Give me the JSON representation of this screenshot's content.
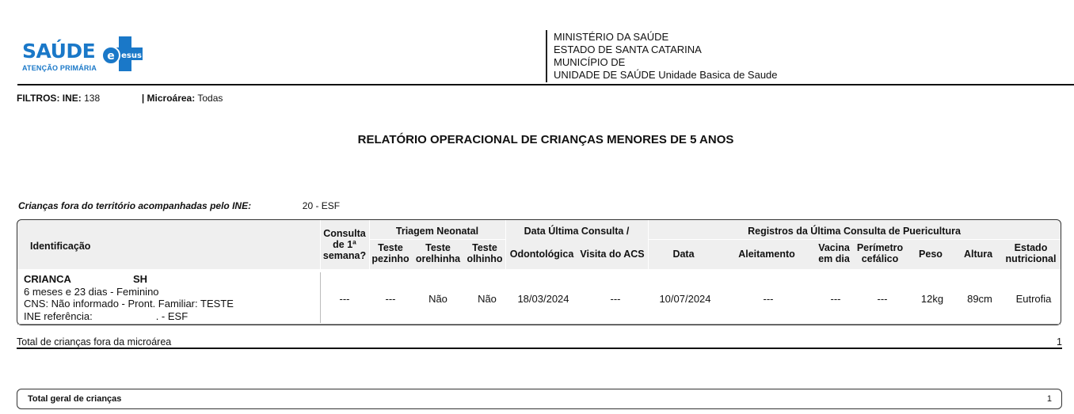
{
  "logo": {
    "word": "SAÚDE",
    "sub": "ATENÇÃO PRIMÁRIA",
    "badge": "esus"
  },
  "header": {
    "line1": "MINISTÉRIO DA SAÚDE",
    "line2": "ESTADO DE SANTA CATARINA",
    "line3": "MUNICÍPIO DE",
    "line4": "UNIDADE DE SAÚDE Unidade Basica de Saude"
  },
  "filters": {
    "ine_label": "FILTROS: INE:",
    "ine_value": "138",
    "microarea_label": "| Microárea:",
    "microarea_value": "Todas"
  },
  "title": "RELATÓRIO OPERACIONAL DE CRIANÇAS MENORES DE 5 ANOS",
  "section": {
    "label": "Crianças fora do território acompanhadas pelo INE:",
    "value": "20 - ESF"
  },
  "table": {
    "headers": {
      "identificacao": "Identificação",
      "consulta": [
        "Consulta",
        "de 1ª",
        "semana?"
      ],
      "triagem": "Triagem Neonatal",
      "teste_pezinho": [
        "Teste",
        "pezinho"
      ],
      "teste_orelhinha": [
        "Teste",
        "orelhinha"
      ],
      "teste_olhinho": [
        "Teste",
        "olhinho"
      ],
      "data_ultima": "Data Última Consulta /",
      "odontologica": "Odontológica",
      "visita_acs": "Visita do ACS",
      "registros": "Registros da Última Consulta de Puericultura",
      "data": "Data",
      "aleitamento": "Aleitamento",
      "vacina": [
        "Vacina",
        "em dia"
      ],
      "perimetro": [
        "Perímetro",
        "cefálico"
      ],
      "peso": "Peso",
      "altura": "Altura",
      "estado": [
        "Estado",
        "nutricional"
      ]
    },
    "row": {
      "name": "CRIANCA",
      "name_suffix": "SH",
      "line2": "6 meses e 23 dias - Feminino",
      "line3": "CNS: Não informado - Pront. Familiar: TESTE",
      "line4": "INE referência:",
      "line4_suffix": ". - ESF",
      "consulta": "---",
      "pezinho": "---",
      "orelhinha": "Não",
      "olhinho": "Não",
      "odontologica": "18/03/2024",
      "visita_acs": "---",
      "data": "10/07/2024",
      "aleitamento": "---",
      "vacina": "---",
      "perimetro": "---",
      "peso": "12kg",
      "altura": "89cm",
      "estado": "Eutrofia"
    }
  },
  "total_fora": {
    "label": "Total de crianças fora da microárea",
    "value": "1"
  },
  "total_geral": {
    "label": "Total geral de crianças",
    "value": "1"
  },
  "colors": {
    "brand_blue": "#1a78c8",
    "header_bg": "#efefef"
  }
}
